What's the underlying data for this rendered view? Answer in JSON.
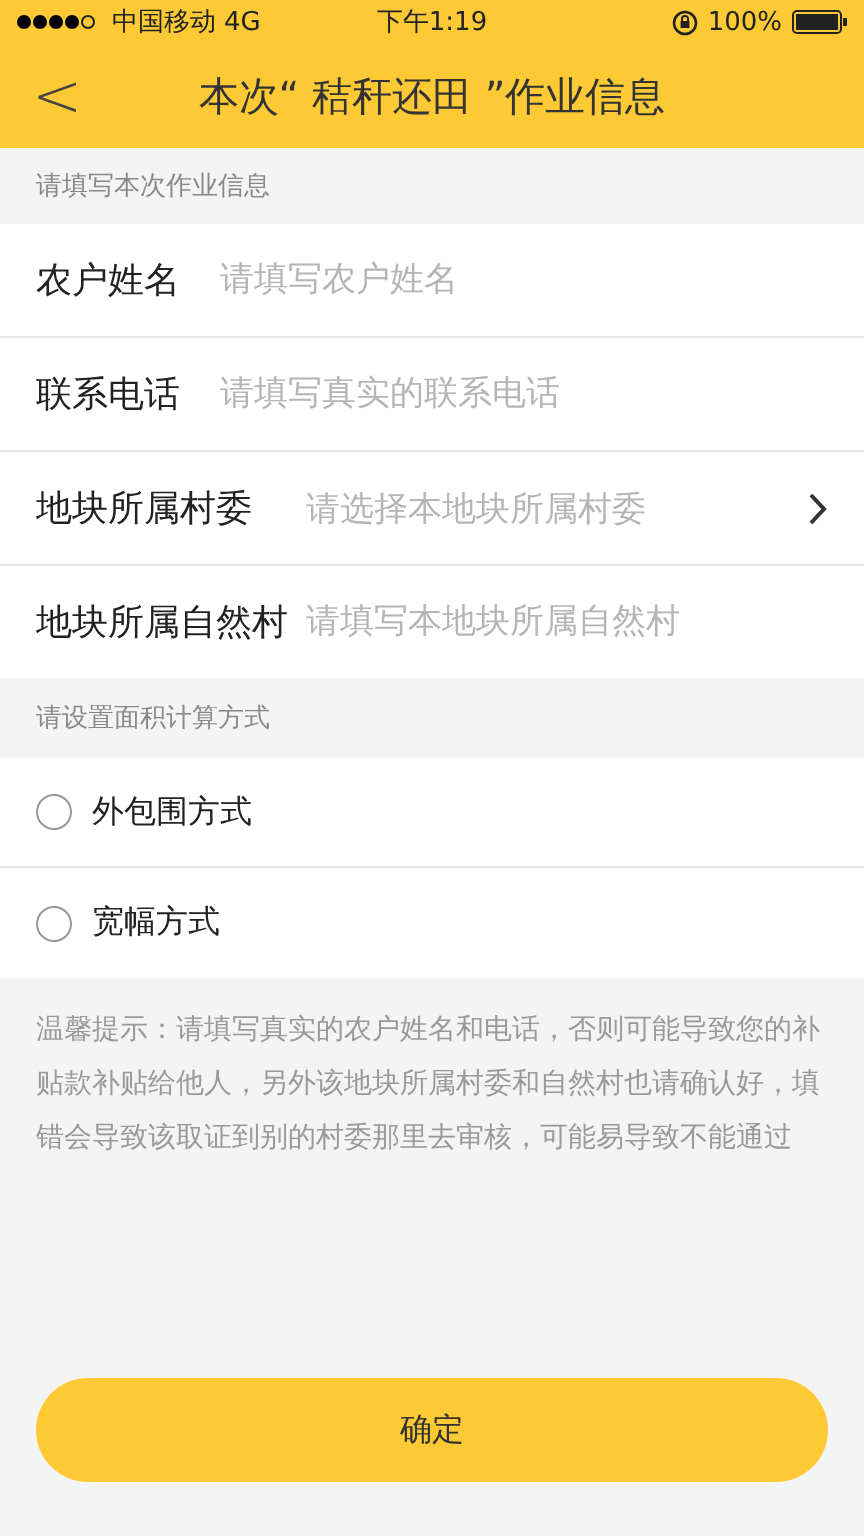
{
  "status_bar": {
    "carrier": "中国移动",
    "network": "4G",
    "time": "下午1:19",
    "battery": "100%"
  },
  "nav": {
    "back": "<",
    "title": "本次“ 秸秆还田 ”作业信息"
  },
  "section_1": {
    "header": "请填写本次作业信息",
    "fields": [
      {
        "kind": "input",
        "label": "农户姓名",
        "placeholder": "请填写农户姓名"
      },
      {
        "kind": "input",
        "label": "联系电话",
        "placeholder": "请填写真实的联系电话"
      },
      {
        "kind": "select",
        "label": "地块所属村委",
        "placeholder": "请选择本地块所属村委"
      },
      {
        "kind": "input",
        "label": "地块所属自然村",
        "placeholder": "请填写本地块所属自然村"
      }
    ]
  },
  "section_2": {
    "header": "请设置面积计算方式",
    "options": [
      {
        "label": "外包围方式",
        "selected": false
      },
      {
        "label": "宽幅方式",
        "selected": false
      }
    ]
  },
  "tip": "温馨提示：请填写真实的农户姓名和电话，否则可能导致您的补贴款补贴给他人，另外该地块所属村委和自然村也请确认好，填错会导致该取证到别的村委那里去审核，可能易导致不能通过",
  "confirm_button": "确定"
}
